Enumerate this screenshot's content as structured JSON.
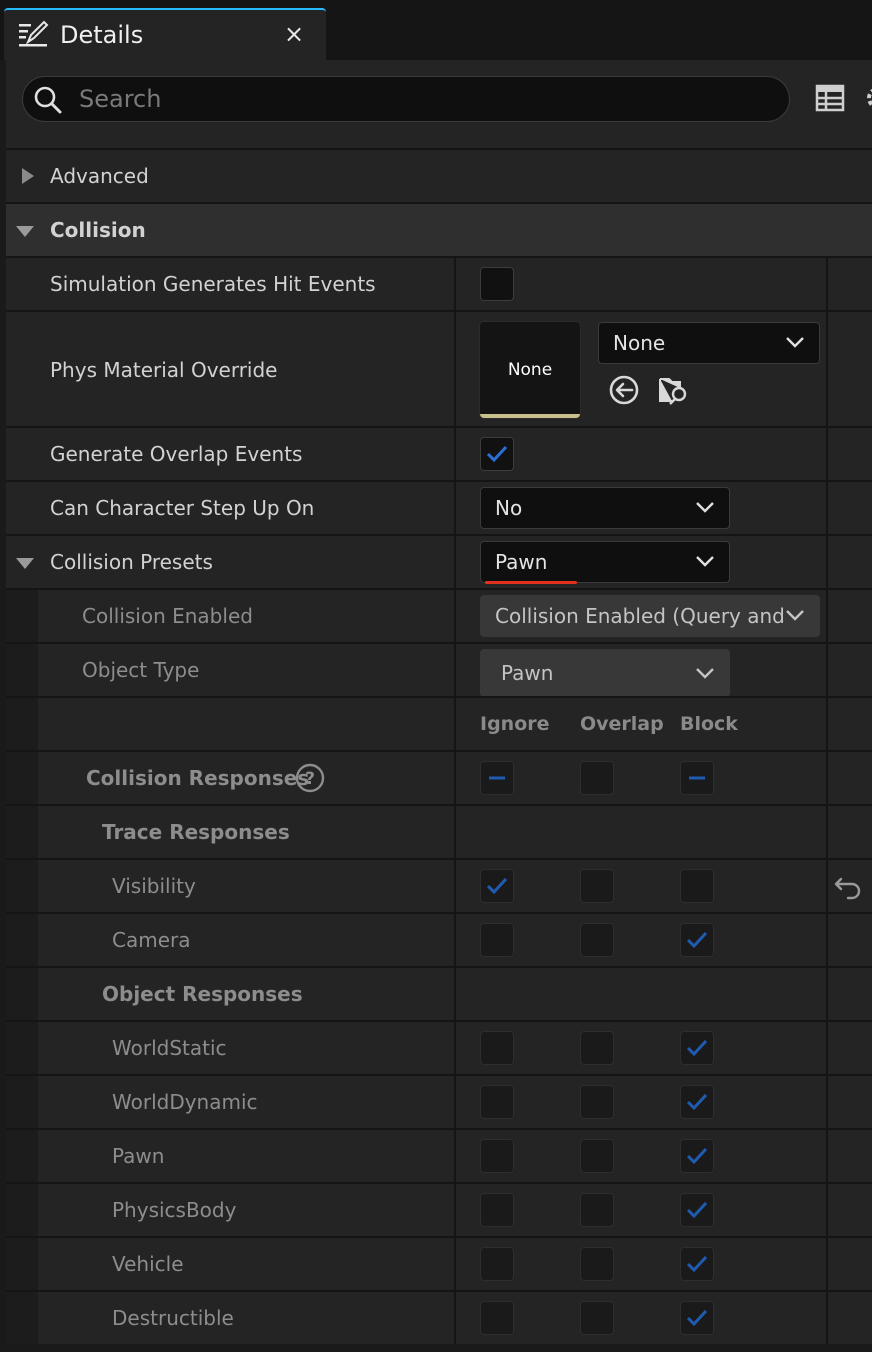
{
  "tab": {
    "title": "Details",
    "close": "×"
  },
  "search": {
    "placeholder": "Search"
  },
  "categories": {
    "advanced": "Advanced",
    "collision": "Collision"
  },
  "properties": {
    "sim_hit": "Simulation Generates Hit Events",
    "phys_material": "Phys Material Override",
    "phys_material_thumb": "None",
    "phys_material_value": "None",
    "overlap_events": "Generate Overlap Events",
    "step_up": "Can Character Step Up On",
    "step_up_value": "No",
    "presets": "Collision Presets",
    "presets_value": "Pawn",
    "collision_enabled": "Collision Enabled",
    "collision_enabled_value": "Collision Enabled (Query and",
    "object_type": "Object Type",
    "object_type_value": "Pawn"
  },
  "columns": {
    "ignore": "Ignore",
    "overlap": "Overlap",
    "block": "Block"
  },
  "responses": {
    "title": "Collision Responses",
    "help": "?",
    "trace_header": "Trace Responses",
    "object_header": "Object Responses",
    "trace": [
      {
        "name": "Visibility",
        "ignore": true,
        "overlap": false,
        "block": false
      },
      {
        "name": "Camera",
        "ignore": false,
        "overlap": false,
        "block": true
      }
    ],
    "objects": [
      {
        "name": "WorldStatic",
        "ignore": false,
        "overlap": false,
        "block": true
      },
      {
        "name": "WorldDynamic",
        "ignore": false,
        "overlap": false,
        "block": true
      },
      {
        "name": "Pawn",
        "ignore": false,
        "overlap": false,
        "block": true
      },
      {
        "name": "PhysicsBody",
        "ignore": false,
        "overlap": false,
        "block": true
      },
      {
        "name": "Vehicle",
        "ignore": false,
        "overlap": false,
        "block": true
      },
      {
        "name": "Destructible",
        "ignore": false,
        "overlap": false,
        "block": true
      }
    ]
  },
  "state": {
    "sim_hit_checked": false,
    "overlap_events_checked": true
  },
  "colors": {
    "accent": "#26bbff",
    "check_blue": "#2a6fd6",
    "check_dim": "#1f5bb0",
    "preset_underline": "#e0301e"
  },
  "icons": [
    "details-icon",
    "close-icon",
    "search-icon",
    "view-options-icon",
    "settings-icon",
    "use-selected-icon",
    "browse-icon",
    "help-icon",
    "reset-icon",
    "chevron-down-icon"
  ]
}
